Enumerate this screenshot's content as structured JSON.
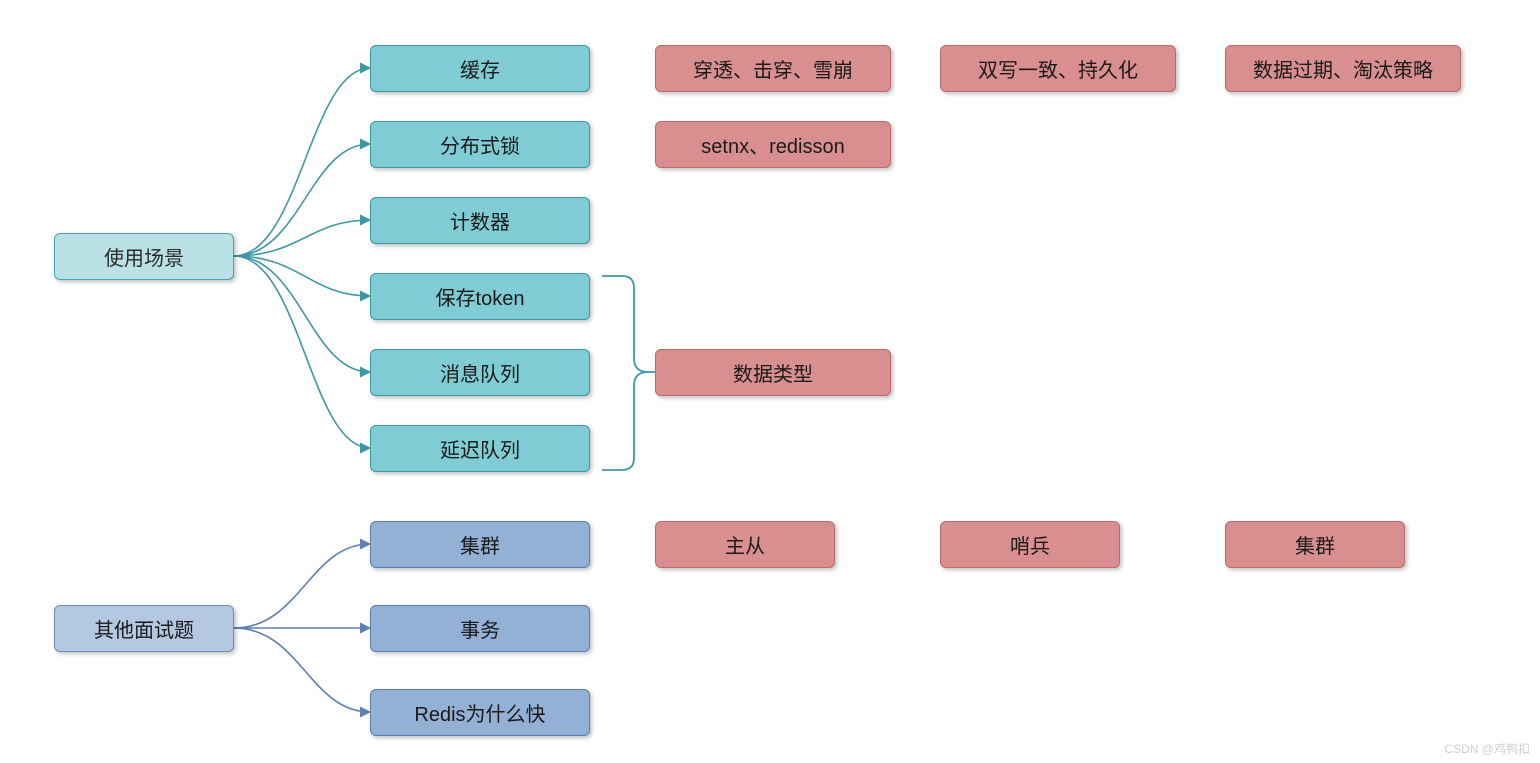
{
  "root1": {
    "label": "使用场景"
  },
  "scenarios": {
    "cache": "缓存",
    "dist_lock": "分布式锁",
    "counter": "计数器",
    "token": "保存token",
    "mq": "消息队列",
    "delay_queue": "延迟队列"
  },
  "cache_topics": {
    "t1": "穿透、击穿、雪崩",
    "t2": "双写一致、持久化",
    "t3": "数据过期、淘汰策略"
  },
  "lock_topics": {
    "t1": "setnx、redisson"
  },
  "data_type": {
    "label": "数据类型"
  },
  "root2": {
    "label": "其他面试题"
  },
  "other": {
    "cluster": "集群",
    "tx": "事务",
    "why_fast": "Redis为什么快"
  },
  "cluster_topics": {
    "t1": "主从",
    "t2": "哨兵",
    "t3": "集群"
  },
  "watermark": "CSDN @鸡鸭扣"
}
